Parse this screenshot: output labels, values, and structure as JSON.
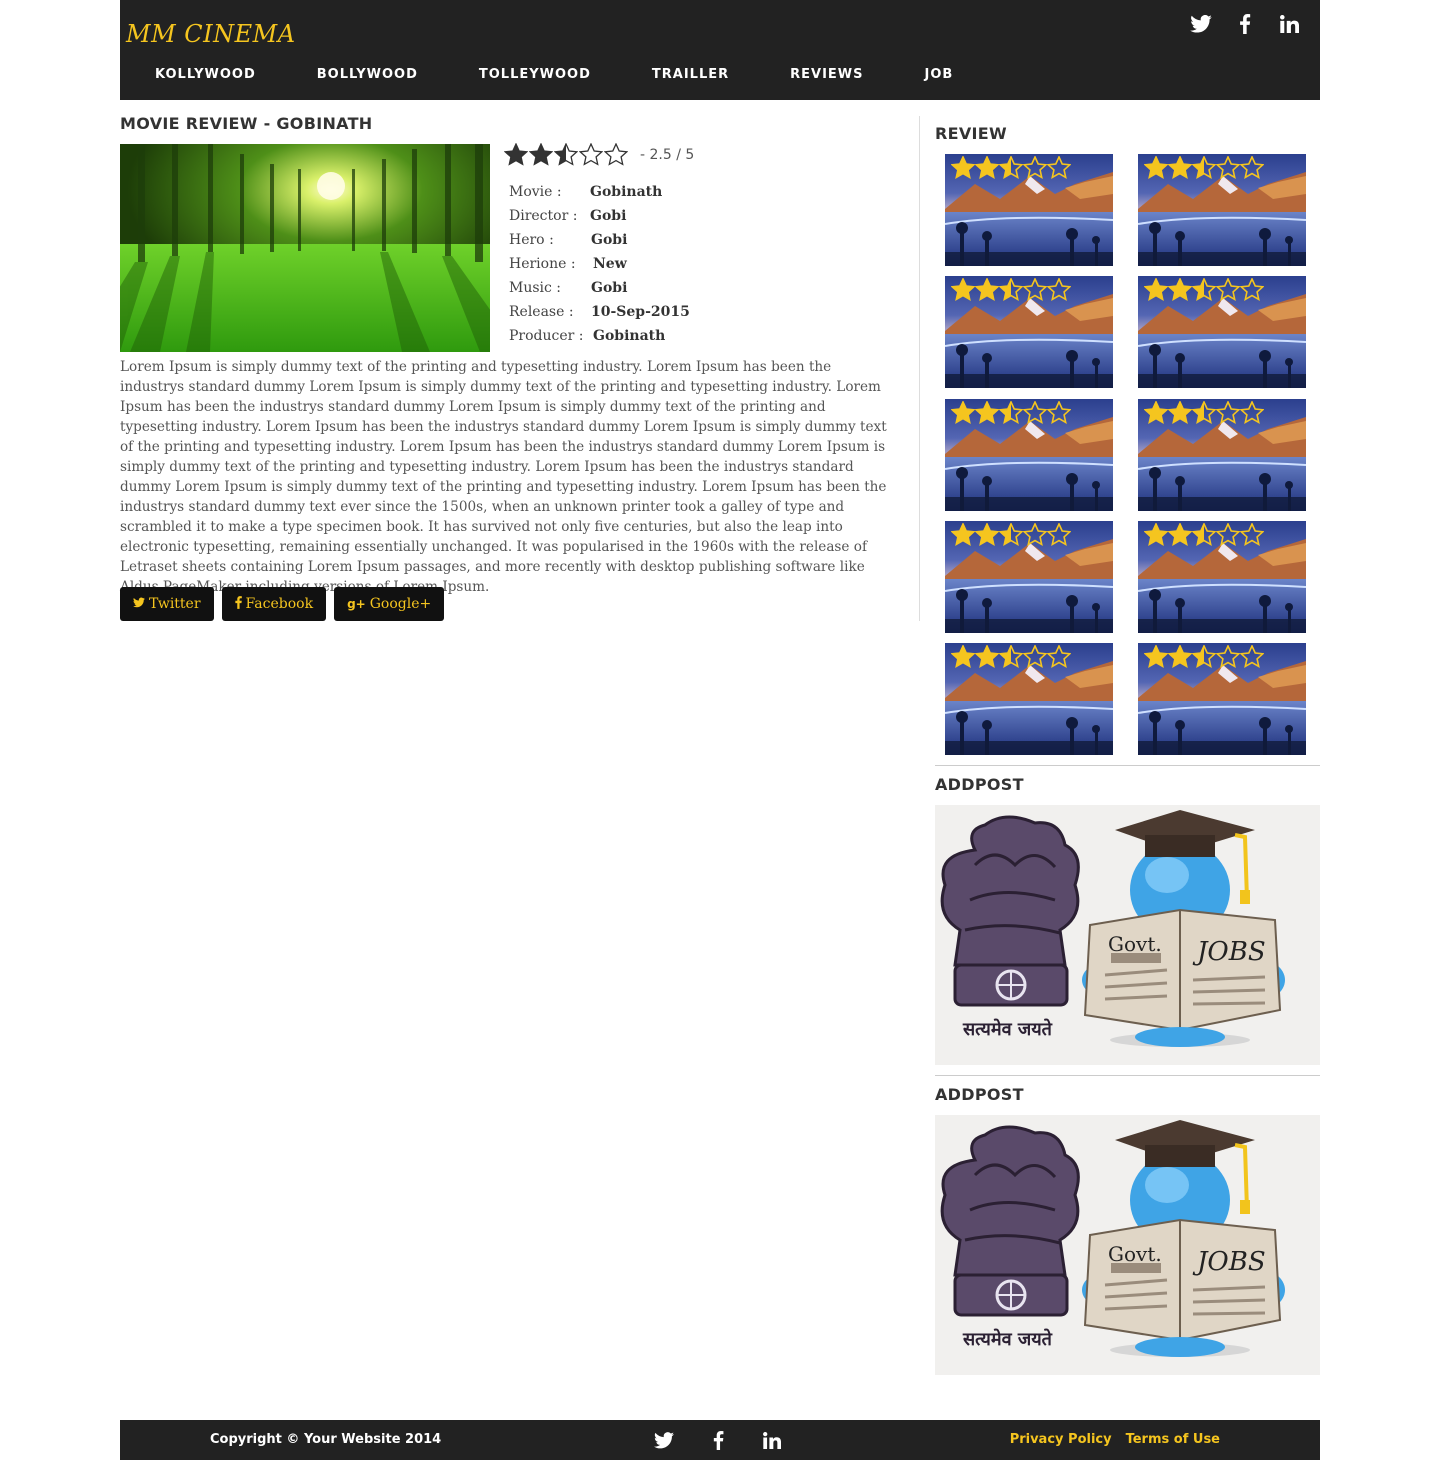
{
  "header": {
    "logo": "MM CINEMA",
    "social": [
      "twitter-icon",
      "facebook-icon",
      "linkedin-icon"
    ],
    "nav": [
      "KOLLYWOOD",
      "BOLLYWOOD",
      "TOLLEYWOOD",
      "TRAILLER",
      "REVIEWS",
      "JOB"
    ]
  },
  "review": {
    "title": "MOVIE REVIEW - GOBINATH",
    "rating": 2.5,
    "rating_max": 5,
    "rating_text": "- 2.5 / 5",
    "details": [
      {
        "label": "Movie :",
        "value": "Gobinath"
      },
      {
        "label": "Director :",
        "value": "Gobi"
      },
      {
        "label": "Hero :",
        "value": "Gobi"
      },
      {
        "label": "Herione :",
        "value": "New"
      },
      {
        "label": "Music :",
        "value": "Gobi"
      },
      {
        "label": "Release :",
        "value": "10-Sep-2015"
      },
      {
        "label": "Producer :",
        "value": "Gobinath"
      }
    ],
    "body": "Lorem Ipsum is simply dummy text of the printing and typesetting industry. Lorem Ipsum has been the industrys standard dummy Lorem Ipsum is simply dummy text of the printing and typesetting industry. Lorem Ipsum has been the industrys standard dummy Lorem Ipsum is simply dummy text of the printing and typesetting industry. Lorem Ipsum has been the industrys standard dummy Lorem Ipsum is simply dummy text of the printing and typesetting industry. Lorem Ipsum has been the industrys standard dummy Lorem Ipsum is simply dummy text of the printing and typesetting industry. Lorem Ipsum has been the industrys standard dummy Lorem Ipsum is simply dummy text of the printing and typesetting industry. Lorem Ipsum has been the industrys standard dummy text ever since the 1500s, when an unknown printer took a galley of type and scrambled it to make a type specimen book. It has survived not only five centuries, but also the leap into electronic typesetting, remaining essentially unchanged. It was popularised in the 1960s with the release of Letraset sheets containing Lorem Ipsum passages, and more recently with desktop publishing software like Aldus PageMaker including versions of Lorem Ipsum.",
    "share": [
      {
        "icon": "twitter-icon",
        "glyph": "♥",
        "label": "Twitter"
      },
      {
        "icon": "facebook-icon",
        "glyph": "f",
        "label": "Facebook"
      },
      {
        "icon": "google-plus-icon",
        "glyph": "g+",
        "label": "Google+"
      }
    ]
  },
  "sidebar": {
    "review_heading": "REVIEW",
    "thumb_rating": 2.5,
    "thumb_count": 10,
    "ad_heading_1": "ADDPOST",
    "ad_heading_2": "ADDPOST",
    "ad_text_govt": "Govt.",
    "ad_text_jobs": "JOBS",
    "ad_text_motto": "सत्यमेव जयते"
  },
  "footer": {
    "copyright": "Copyright © Your Website 2014",
    "links": [
      "Privacy Policy",
      "Terms of Use"
    ]
  },
  "colors": {
    "dark": "#222222",
    "accent": "#f5c51f",
    "star_fill": "#f5c51f"
  }
}
